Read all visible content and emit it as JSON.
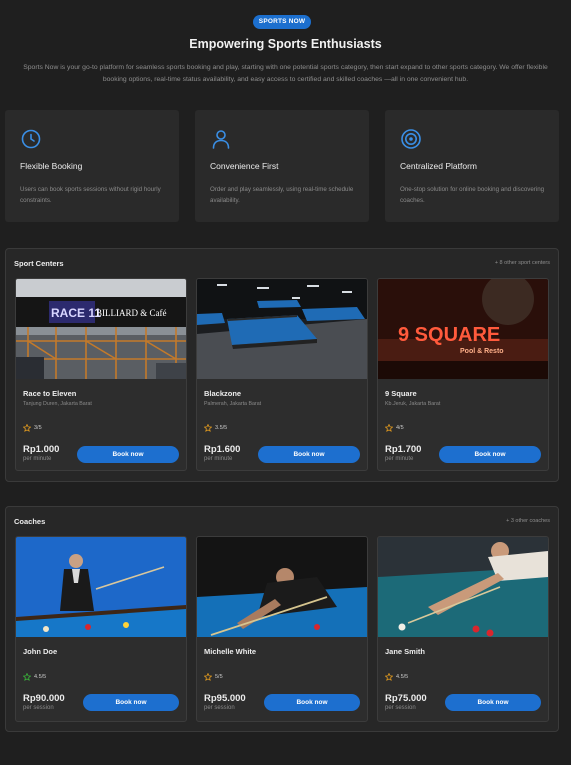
{
  "hero": {
    "badge": "SPORTS NOW",
    "title": "Empowering Sports Enthusiasts",
    "description": "Sports Now is your go-to platform for seamless sports booking and play, starting with one potential sports category, then start expand to other sports category. We offer flexible booking options, real-time status availability, and easy access to certified and skilled coaches —all in one convenient hub."
  },
  "features": [
    {
      "icon": "clock-icon",
      "title": "Flexible Booking",
      "description": "Users can book sports sessions without rigid hourly constraints."
    },
    {
      "icon": "person-icon",
      "title": "Convenience First",
      "description": "Order and play seamlessly, using real-time schedule availability."
    },
    {
      "icon": "target-icon",
      "title": "Centralized Platform",
      "description": "One-stop solution for online booking and discovering coaches."
    }
  ],
  "sport_centers": {
    "title": "Sport Centers",
    "more": "+ 8 other sport centers",
    "items": [
      {
        "name": "Race to Eleven",
        "location": "Tanjung Duren, Jakarta Barat",
        "rating": "3/5",
        "price": "Rp1.000",
        "unit": "per minute",
        "button": "Book now",
        "sign_text": "BILLIARD & Café",
        "logo_text": "RACE 11"
      },
      {
        "name": "Blackzone",
        "location": "Palmerah, Jakarta Barat",
        "rating": "3.5/5",
        "price": "Rp1.600",
        "unit": "per minute",
        "button": "Book now"
      },
      {
        "name": "9 Square",
        "location": "Kb.Jeruk, Jakarta Barat",
        "rating": "4/5",
        "price": "Rp1.700",
        "unit": "per minute",
        "button": "Book now",
        "sign_text": "9 SQUARE",
        "sign_sub": "Pool & Resto"
      }
    ]
  },
  "coaches": {
    "title": "Coaches",
    "more": "+ 3 other coaches",
    "items": [
      {
        "name": "John Doe",
        "rating": "4.5/5",
        "price": "Rp90.000",
        "unit": "per session",
        "button": "Book now"
      },
      {
        "name": "Michelle White",
        "rating": "5/5",
        "price": "Rp95.000",
        "unit": "per session",
        "button": "Book now"
      },
      {
        "name": "Jane Smith",
        "rating": "4.5/5",
        "price": "Rp75.000",
        "unit": "per session",
        "button": "Book now"
      }
    ]
  },
  "colors": {
    "accent": "#1d6fcf",
    "star": "#f0a31e",
    "star_green": "#3bbf3b",
    "background": "#1f1f1f"
  }
}
